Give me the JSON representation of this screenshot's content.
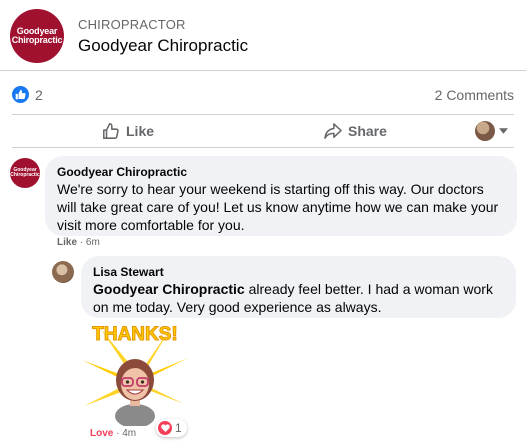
{
  "header": {
    "avatar_text_line1": "Goodyear",
    "avatar_text_line2": "Chiropractic",
    "category": "CHIROPRACTOR",
    "page_name": "Goodyear Chiropractic"
  },
  "stats": {
    "likes": "2",
    "comments": "2 Comments"
  },
  "actions": {
    "like_label": "Like",
    "share_label": "Share"
  },
  "comment": {
    "author": "Goodyear Chiropractic",
    "text": "We're sorry to hear your weekend is starting off this way. Our doctors will take great care of you! Let us know anytime how we can make your visit more comfortable for you.",
    "like_label": "Like",
    "time": "· 6m"
  },
  "reply": {
    "author": "Lisa Stewart",
    "mention": "Goodyear Chiropractic",
    "text": " already feel better. I had a woman work on me today. Very good experience as always.",
    "sticker_text": "THANKS!",
    "reaction_label": "Love",
    "time": "· 4m",
    "reaction_count": "1"
  },
  "colors": {
    "brand": "#a01130",
    "accent": "#1877f2",
    "love": "#f33e58"
  }
}
